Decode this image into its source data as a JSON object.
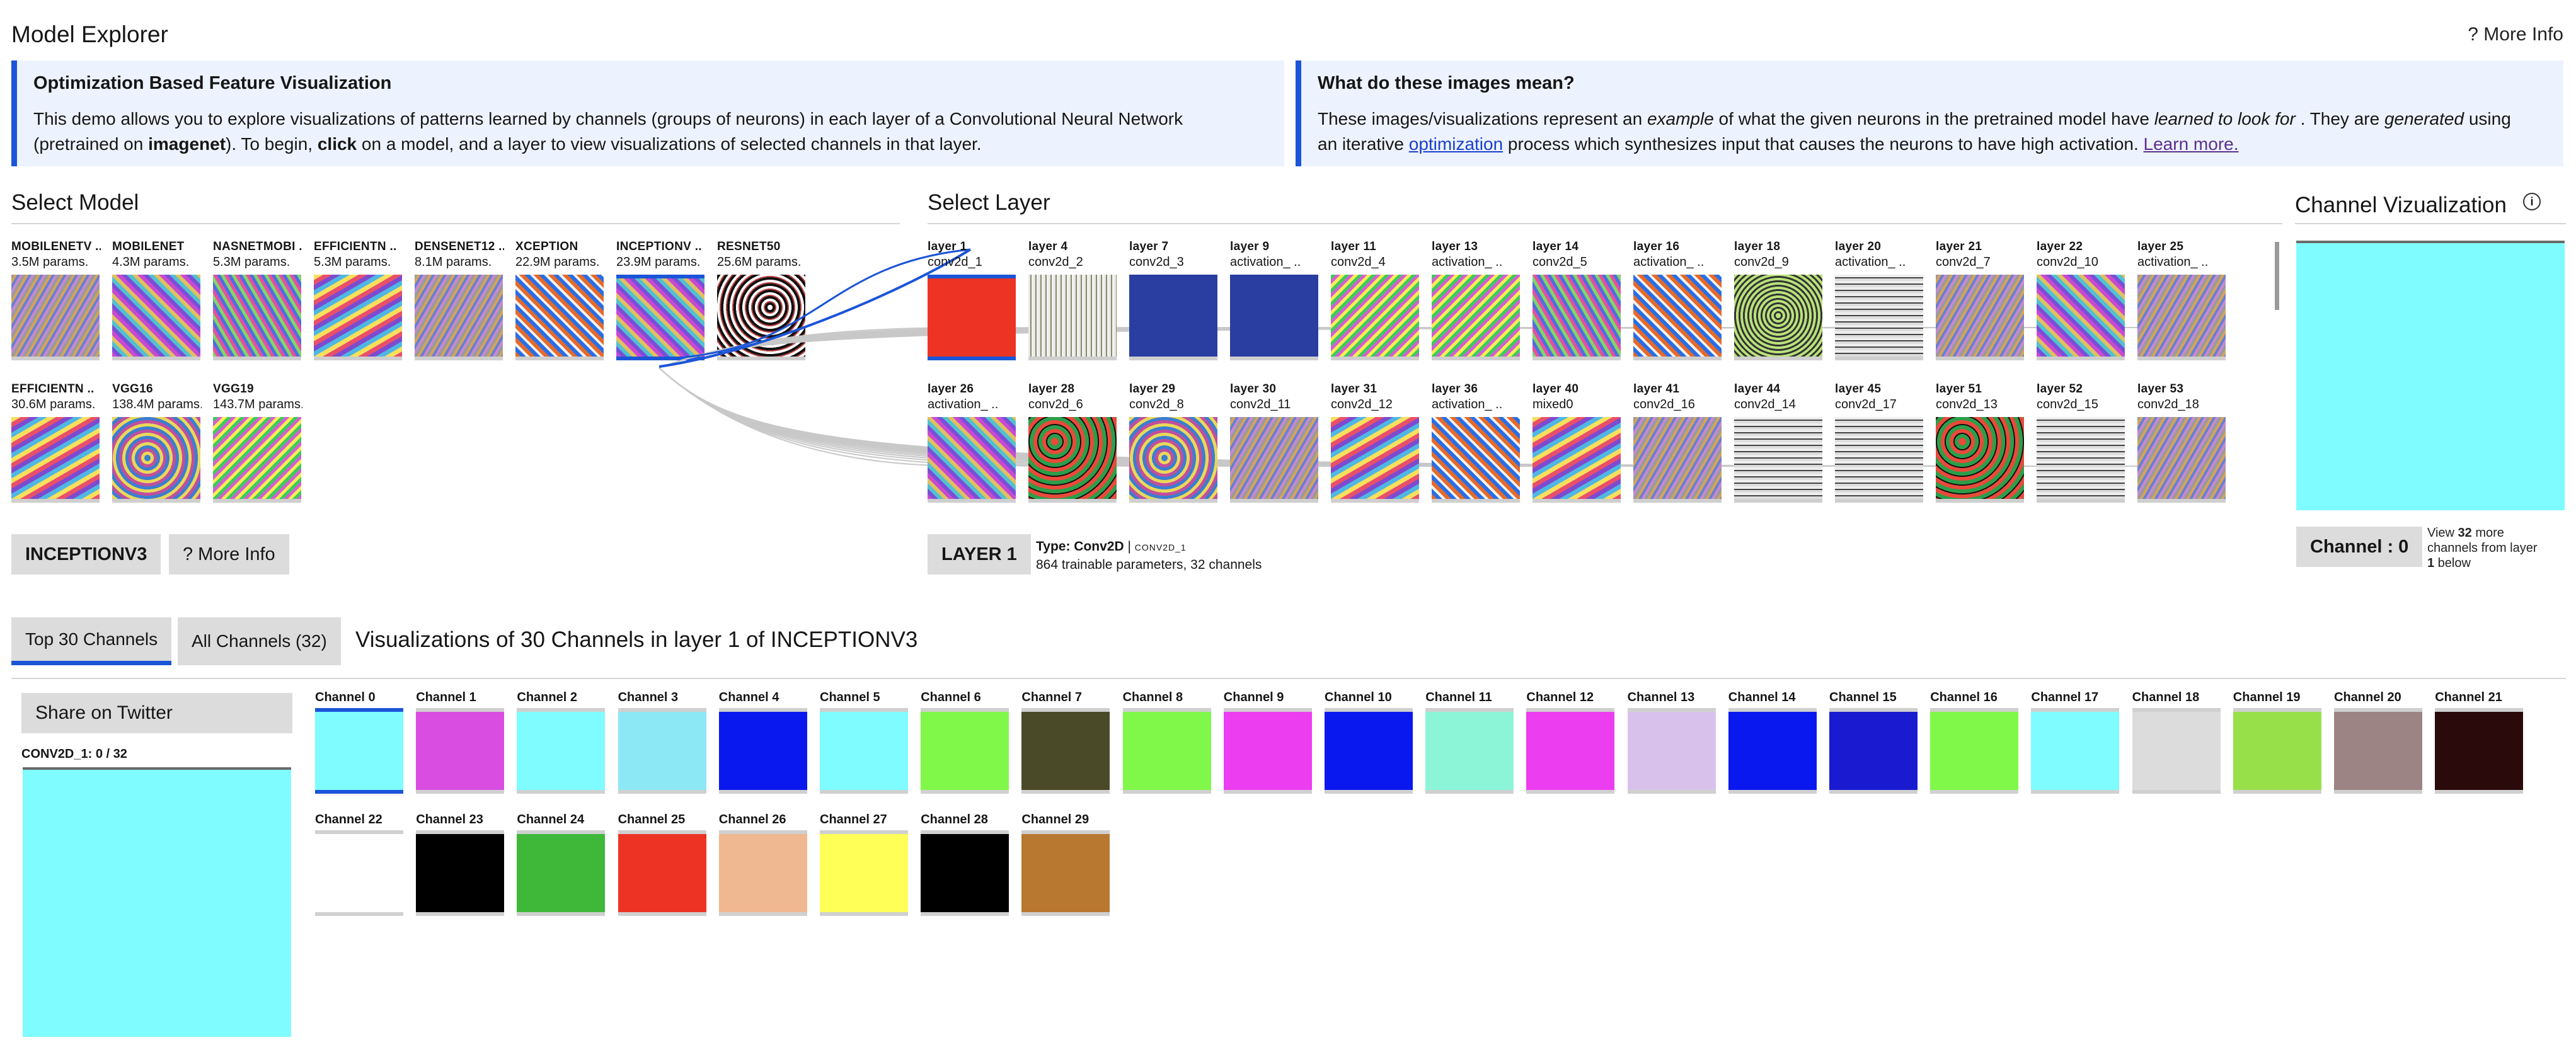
{
  "header": {
    "title": "Model Explorer",
    "more_info": "? More Info"
  },
  "intro_left": {
    "title": "Optimization Based Feature Visualization",
    "p1": "This demo allows you to explore visualizations of patterns learned by channels (groups of neurons) in each layer of a Convolutional Neural Network",
    "p2a": "(pretrained on ",
    "p2b": "imagenet",
    "p2c": "). To begin, ",
    "p2d": "click",
    "p2e": " on a model, and a layer to view visualizations of selected channels in that layer."
  },
  "intro_right": {
    "title": "What do these images mean?",
    "l1a": "These images/visualizations represent an ",
    "l1b": "example",
    "l1c": " of what the given neurons in the pretrained model have ",
    "l1d": "learned to look for",
    "l1e": " . They are ",
    "l1f": "generated",
    "l1g": " using",
    "l2a": "an iterative ",
    "l2b": "optimization",
    "l2c": " process which synthesizes input that causes the neurons to have high activation. ",
    "l2d": "Learn more."
  },
  "select_model": {
    "title": "Select Model",
    "models": [
      {
        "name": "MOBILENETV ..",
        "params": "3.5M params."
      },
      {
        "name": "MOBILENET",
        "params": "4.3M params."
      },
      {
        "name": "NASNETMOBI ..",
        "params": "5.3M params."
      },
      {
        "name": "EFFICIENTN ..",
        "params": "5.3M params."
      },
      {
        "name": "DENSENET12 ..",
        "params": "8.1M params."
      },
      {
        "name": "XCEPTION",
        "params": "22.9M params."
      },
      {
        "name": "INCEPTIONV ..",
        "params": "23.9M params."
      },
      {
        "name": "RESNET50",
        "params": "25.6M params."
      },
      {
        "name": "EFFICIENTN ..",
        "params": "30.6M params."
      },
      {
        "name": "VGG16",
        "params": "138.4M params."
      },
      {
        "name": "VGG19",
        "params": "143.7M params."
      }
    ],
    "selected_button": "INCEPTIONV3",
    "more_info": "? More Info"
  },
  "select_layer": {
    "title": "Select Layer",
    "layers": [
      {
        "name": "layer 1",
        "op": "conv2d_1"
      },
      {
        "name": "layer 4",
        "op": "conv2d_2"
      },
      {
        "name": "layer 7",
        "op": "conv2d_3"
      },
      {
        "name": "layer 9",
        "op": "activation_ .."
      },
      {
        "name": "layer 11",
        "op": "conv2d_4"
      },
      {
        "name": "layer 13",
        "op": "activation_ .."
      },
      {
        "name": "layer 14",
        "op": "conv2d_5"
      },
      {
        "name": "layer 16",
        "op": "activation_ .."
      },
      {
        "name": "layer 18",
        "op": "conv2d_9"
      },
      {
        "name": "layer 20",
        "op": "activation_ .."
      },
      {
        "name": "layer 21",
        "op": "conv2d_7"
      },
      {
        "name": "layer 22",
        "op": "conv2d_10"
      },
      {
        "name": "layer 25",
        "op": "activation_ .."
      },
      {
        "name": "layer 26",
        "op": "activation_ .."
      },
      {
        "name": "layer 28",
        "op": "conv2d_6"
      },
      {
        "name": "layer 29",
        "op": "conv2d_8"
      },
      {
        "name": "layer 30",
        "op": "conv2d_11"
      },
      {
        "name": "layer 31",
        "op": "conv2d_12"
      },
      {
        "name": "layer 36",
        "op": "activation_ .."
      },
      {
        "name": "layer 40",
        "op": "mixed0"
      },
      {
        "name": "layer 41",
        "op": "conv2d_16"
      },
      {
        "name": "layer 44",
        "op": "conv2d_14"
      },
      {
        "name": "layer 45",
        "op": "conv2d_17"
      },
      {
        "name": "layer 51",
        "op": "conv2d_13"
      },
      {
        "name": "layer 52",
        "op": "conv2d_15"
      },
      {
        "name": "layer 53",
        "op": "conv2d_18"
      }
    ],
    "selected_button": "LAYER 1",
    "type_label": "Type: Conv2D",
    "type_sep": " | ",
    "type_op": "CONV2D_1",
    "params_text": "864 trainable parameters, 32 channels"
  },
  "channel_viz": {
    "title": "Channel Vizualization",
    "info_icon": "i",
    "channel_button": "Channel : 0",
    "view_a": "View ",
    "view_b": "32",
    "view_c": " more",
    "view_d": "channels from layer",
    "view_e": "1",
    "view_f": " below",
    "color": "#7ffcff"
  },
  "channels_section": {
    "tab_top": "Top 30 Channels",
    "tab_all": "All Channels (32)",
    "heading": "Visualizations of 30 Channels in layer 1 of INCEPTIONV3",
    "share_button": "Share on Twitter",
    "selected_caption": "CONV2D_1: 0 / 32",
    "channels": [
      {
        "name": "Channel 0",
        "color": "#7ffcff"
      },
      {
        "name": "Channel 1",
        "color": "#d94ee0"
      },
      {
        "name": "Channel 2",
        "color": "#7ffcff"
      },
      {
        "name": "Channel 3",
        "color": "#8de8f5"
      },
      {
        "name": "Channel 4",
        "color": "#0a18f0"
      },
      {
        "name": "Channel 5",
        "color": "#7ffcff"
      },
      {
        "name": "Channel 6",
        "color": "#7ff84a"
      },
      {
        "name": "Channel 7",
        "color": "#4a4a28"
      },
      {
        "name": "Channel 8",
        "color": "#7ff84a"
      },
      {
        "name": "Channel 9",
        "color": "#ec3df0"
      },
      {
        "name": "Channel 10",
        "color": "#0a18f0"
      },
      {
        "name": "Channel 11",
        "color": "#8cf5d8"
      },
      {
        "name": "Channel 12",
        "color": "#ec3df0"
      },
      {
        "name": "Channel 13",
        "color": "#d8c2ec"
      },
      {
        "name": "Channel 14",
        "color": "#0a18f0"
      },
      {
        "name": "Channel 15",
        "color": "#1a1ad0"
      },
      {
        "name": "Channel 16",
        "color": "#7ff84a"
      },
      {
        "name": "Channel 17",
        "color": "#7ffcff"
      },
      {
        "name": "Channel 18",
        "color": "#dcdcdc"
      },
      {
        "name": "Channel 19",
        "color": "#98e04a"
      },
      {
        "name": "Channel 20",
        "color": "#9c8484"
      },
      {
        "name": "Channel 21",
        "color": "#2a0a0a"
      },
      {
        "name": "Channel 22",
        "color": "#ffffff"
      },
      {
        "name": "Channel 23",
        "color": "#000000"
      },
      {
        "name": "Channel 24",
        "color": "#3fb83a"
      },
      {
        "name": "Channel 25",
        "color": "#ec3324"
      },
      {
        "name": "Channel 26",
        "color": "#f0b890"
      },
      {
        "name": "Channel 27",
        "color": "#ffff58"
      },
      {
        "name": "Channel 28",
        "color": "#000000"
      },
      {
        "name": "Channel 29",
        "color": "#b87830"
      }
    ]
  },
  "colors": {
    "accent": "#1b55d8",
    "info_bg": "#edf3fe",
    "button_gray": "#dcdcdc"
  }
}
